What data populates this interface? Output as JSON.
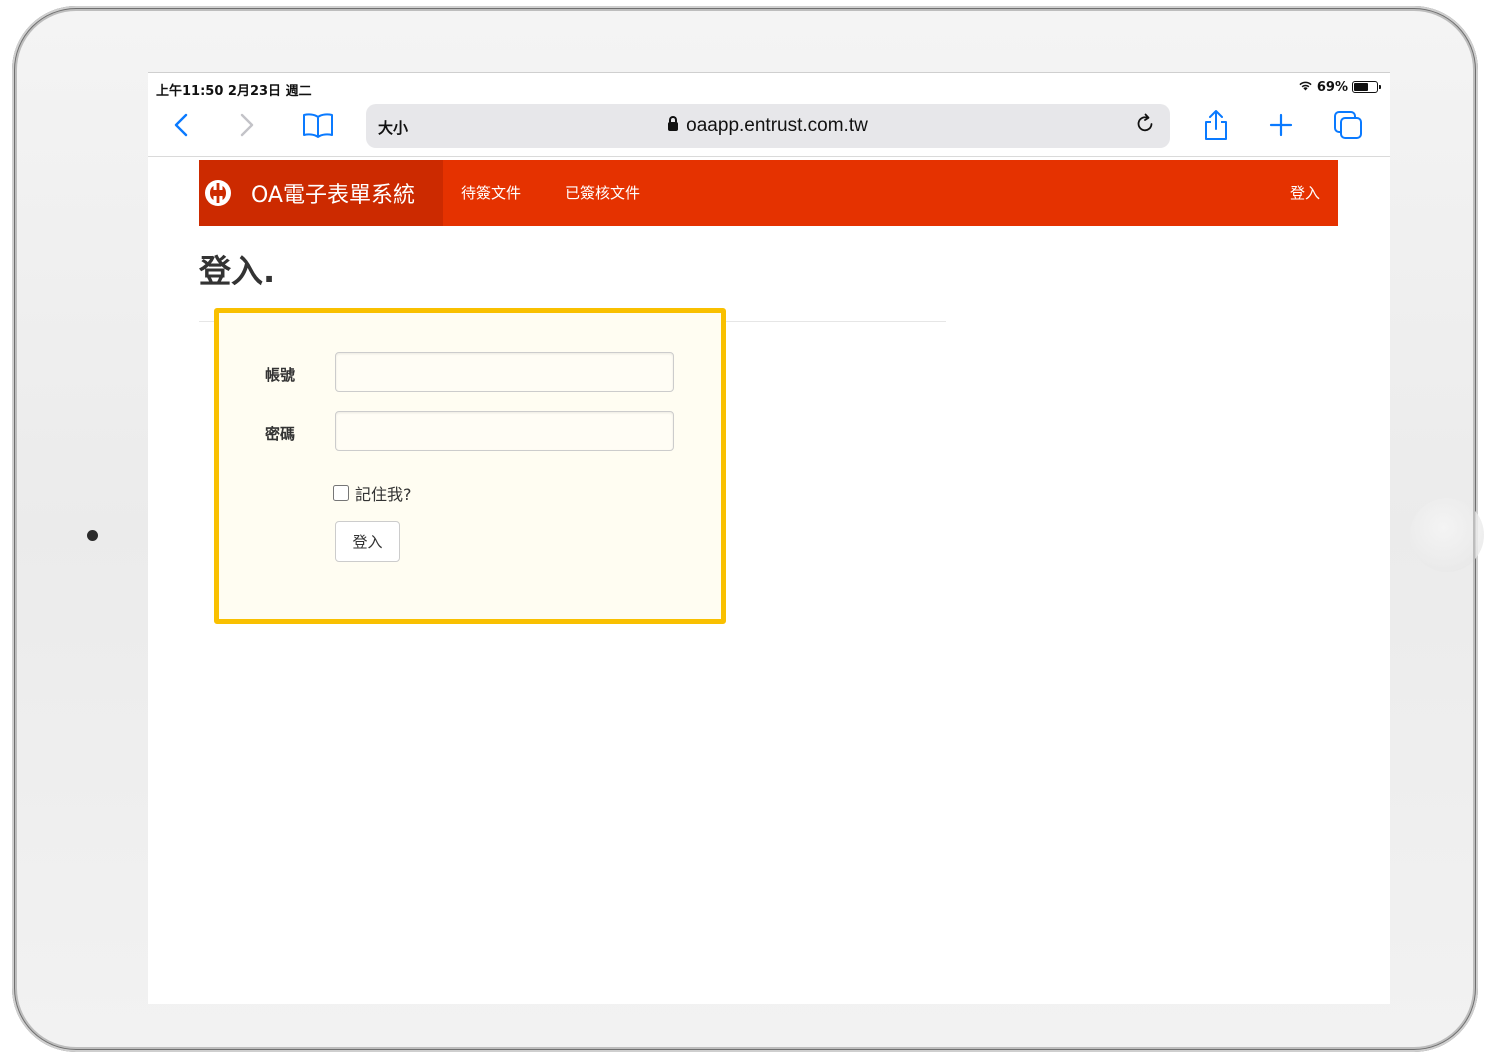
{
  "status_bar": {
    "time": "上午11:50  2月23日 週二",
    "battery_percent": "69%",
    "battery_level": 0.69
  },
  "browser": {
    "text_size_label": "大小",
    "url": "oaapp.entrust.com.tw",
    "accent_color": "#0a7aff"
  },
  "site": {
    "brand_title": "OA電子表單系統",
    "nav_color": "#e53200",
    "nav_links": {
      "pending": "待簽文件",
      "signed": "已簽核文件"
    },
    "login_link": "登入"
  },
  "page": {
    "title": "登入.",
    "highlight_color": "#f9c000"
  },
  "form": {
    "account_label": "帳號",
    "account_value": "",
    "password_label": "密碼",
    "password_value": "",
    "remember_label": "記住我?",
    "remember_checked": false,
    "submit_label": "登入"
  }
}
